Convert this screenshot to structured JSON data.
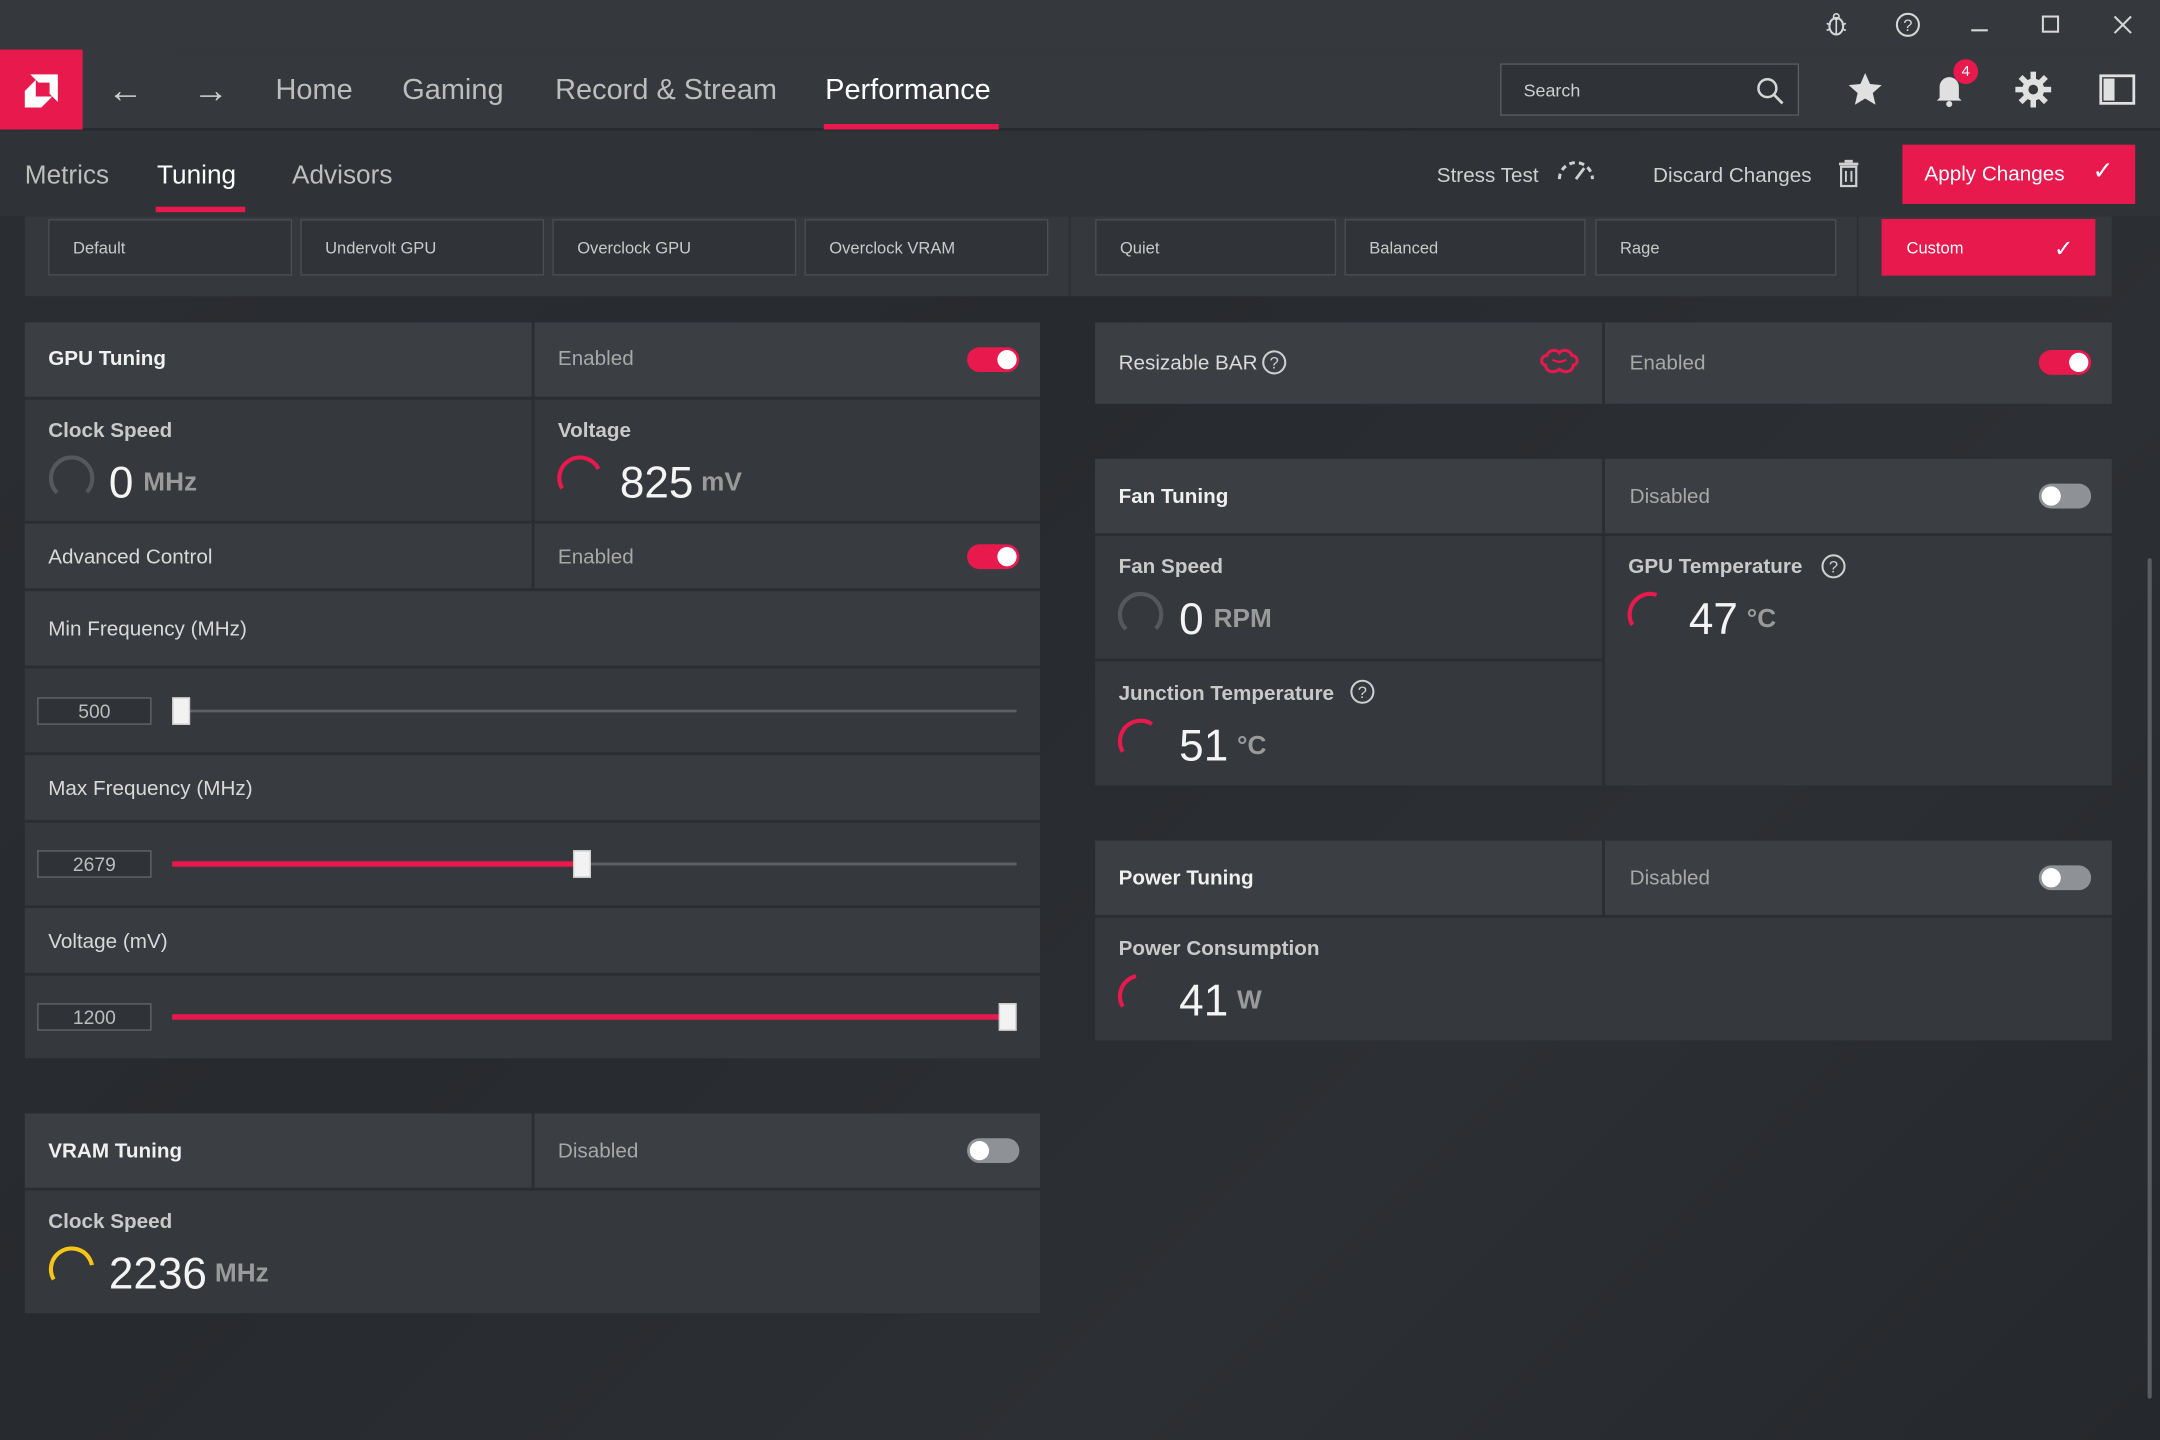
{
  "titlebar": {
    "icons": [
      "bug-report-icon",
      "help-circle-icon",
      "minimize-icon",
      "maximize-icon",
      "close-icon"
    ]
  },
  "nav": {
    "items": [
      "Home",
      "Gaming",
      "Record & Stream",
      "Performance"
    ],
    "active": "Performance",
    "search_placeholder": "Search",
    "notification_count": "4"
  },
  "subnav": {
    "tabs": [
      "Metrics",
      "Tuning",
      "Advisors"
    ],
    "active": "Tuning",
    "stress_test": "Stress Test",
    "discard_changes": "Discard Changes",
    "apply_changes": "Apply Changes"
  },
  "presets": {
    "gpu": [
      "Default",
      "Undervolt GPU",
      "Overclock GPU",
      "Overclock VRAM"
    ],
    "fan": [
      "Quiet",
      "Balanced",
      "Rage"
    ],
    "custom": "Custom"
  },
  "gpu_tuning": {
    "title": "GPU Tuning",
    "status": "Enabled",
    "enabled": true,
    "clock_speed": {
      "label": "Clock Speed",
      "value": "0",
      "unit": "MHz"
    },
    "voltage": {
      "label": "Voltage",
      "value": "825",
      "unit": "mV"
    },
    "advanced_control": {
      "label": "Advanced Control",
      "status": "Enabled",
      "enabled": true
    },
    "min_frequency": {
      "label": "Min Frequency (MHz)",
      "value": "500",
      "fraction": 0.0
    },
    "max_frequency": {
      "label": "Max Frequency (MHz)",
      "value": "2679",
      "fraction": 0.49
    },
    "voltage_slider": {
      "label": "Voltage (mV)",
      "value": "1200",
      "fraction": 1.0
    }
  },
  "vram_tuning": {
    "title": "VRAM Tuning",
    "status": "Disabled",
    "enabled": false,
    "clock_speed": {
      "label": "Clock Speed",
      "value": "2236",
      "unit": "MHz"
    }
  },
  "resizable_bar": {
    "title": "Resizable BAR",
    "status": "Enabled",
    "enabled": true
  },
  "fan_tuning": {
    "title": "Fan Tuning",
    "status": "Disabled",
    "enabled": false,
    "fan_speed": {
      "label": "Fan Speed",
      "value": "0",
      "unit": "RPM"
    },
    "gpu_temperature": {
      "label": "GPU Temperature",
      "value": "47",
      "unit": "°C"
    },
    "junction_temperature": {
      "label": "Junction Temperature",
      "value": "51",
      "unit": "°C"
    }
  },
  "power_tuning": {
    "title": "Power Tuning",
    "status": "Disabled",
    "enabled": false,
    "power_consumption": {
      "label": "Power Consumption",
      "value": "41",
      "unit": "W"
    }
  },
  "colors": {
    "accent": "#e8194d",
    "gauge_yellow": "#f5c518",
    "background": "#2a2d31",
    "panel": "#35383c"
  }
}
